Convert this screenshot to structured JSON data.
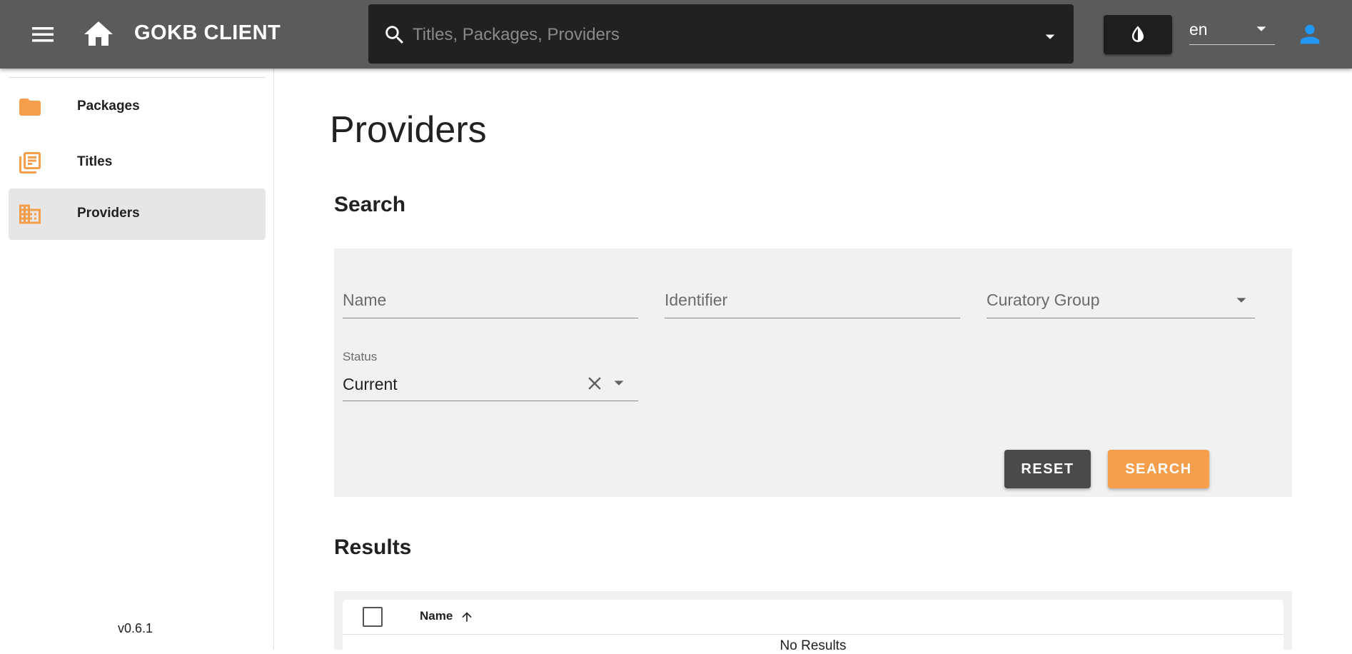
{
  "header": {
    "title": "GOKB CLIENT",
    "search_placeholder": "Titles, Packages, Providers",
    "language": "en",
    "icons": [
      "menu-icon",
      "home-icon",
      "search-icon",
      "chevron-down-icon",
      "contrast-icon",
      "account-icon"
    ]
  },
  "sidebar": {
    "items": [
      {
        "label": "Packages",
        "icon": "folder-icon"
      },
      {
        "label": "Titles",
        "icon": "library-books-icon"
      },
      {
        "label": "Providers",
        "icon": "domain-icon",
        "active": true
      }
    ],
    "version": "v0.6.1"
  },
  "main": {
    "title": "Providers",
    "search_section": {
      "title": "Search",
      "fields": {
        "name_placeholder": "Name",
        "identifier_placeholder": "Identifier",
        "curatory_group_placeholder": "Curatory Group",
        "status_label": "Status",
        "status_value": "Current"
      },
      "reset_label": "RESET",
      "search_label": "SEARCH"
    },
    "results_section": {
      "title": "Results",
      "columns": [
        "Name"
      ],
      "empty_text": "No Results"
    }
  },
  "colors": {
    "appbar": "#5b5b5b",
    "accent": "#f59f4c",
    "account_icon": "#2196f3",
    "reset_button": "#4a4a4a"
  }
}
